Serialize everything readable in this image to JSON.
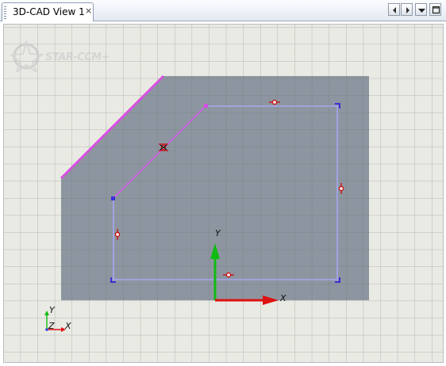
{
  "tab": {
    "label": "3D-CAD View 1",
    "close_glyph": "×"
  },
  "window_controls": {
    "icons": [
      "scroll-left-icon",
      "scroll-right-icon",
      "dropdown-icon",
      "maximize-icon"
    ]
  },
  "watermark": {
    "text": "STAR-CCM+"
  },
  "axes": {
    "sketch": {
      "x_label": "X",
      "y_label": "Y"
    },
    "triad": {
      "x_label": "X",
      "y_label": "Y",
      "z_label": "Z"
    }
  },
  "colors": {
    "viewport_bg": "#eaeae4",
    "grid": "#b4b6b4",
    "body": "#8d96a0",
    "sketch": "#9f9cf0",
    "highlight_edge": "#d94fe2",
    "constraint": "#cc0000",
    "x_axis": "#dd1111",
    "y_axis": "#11bb11"
  }
}
